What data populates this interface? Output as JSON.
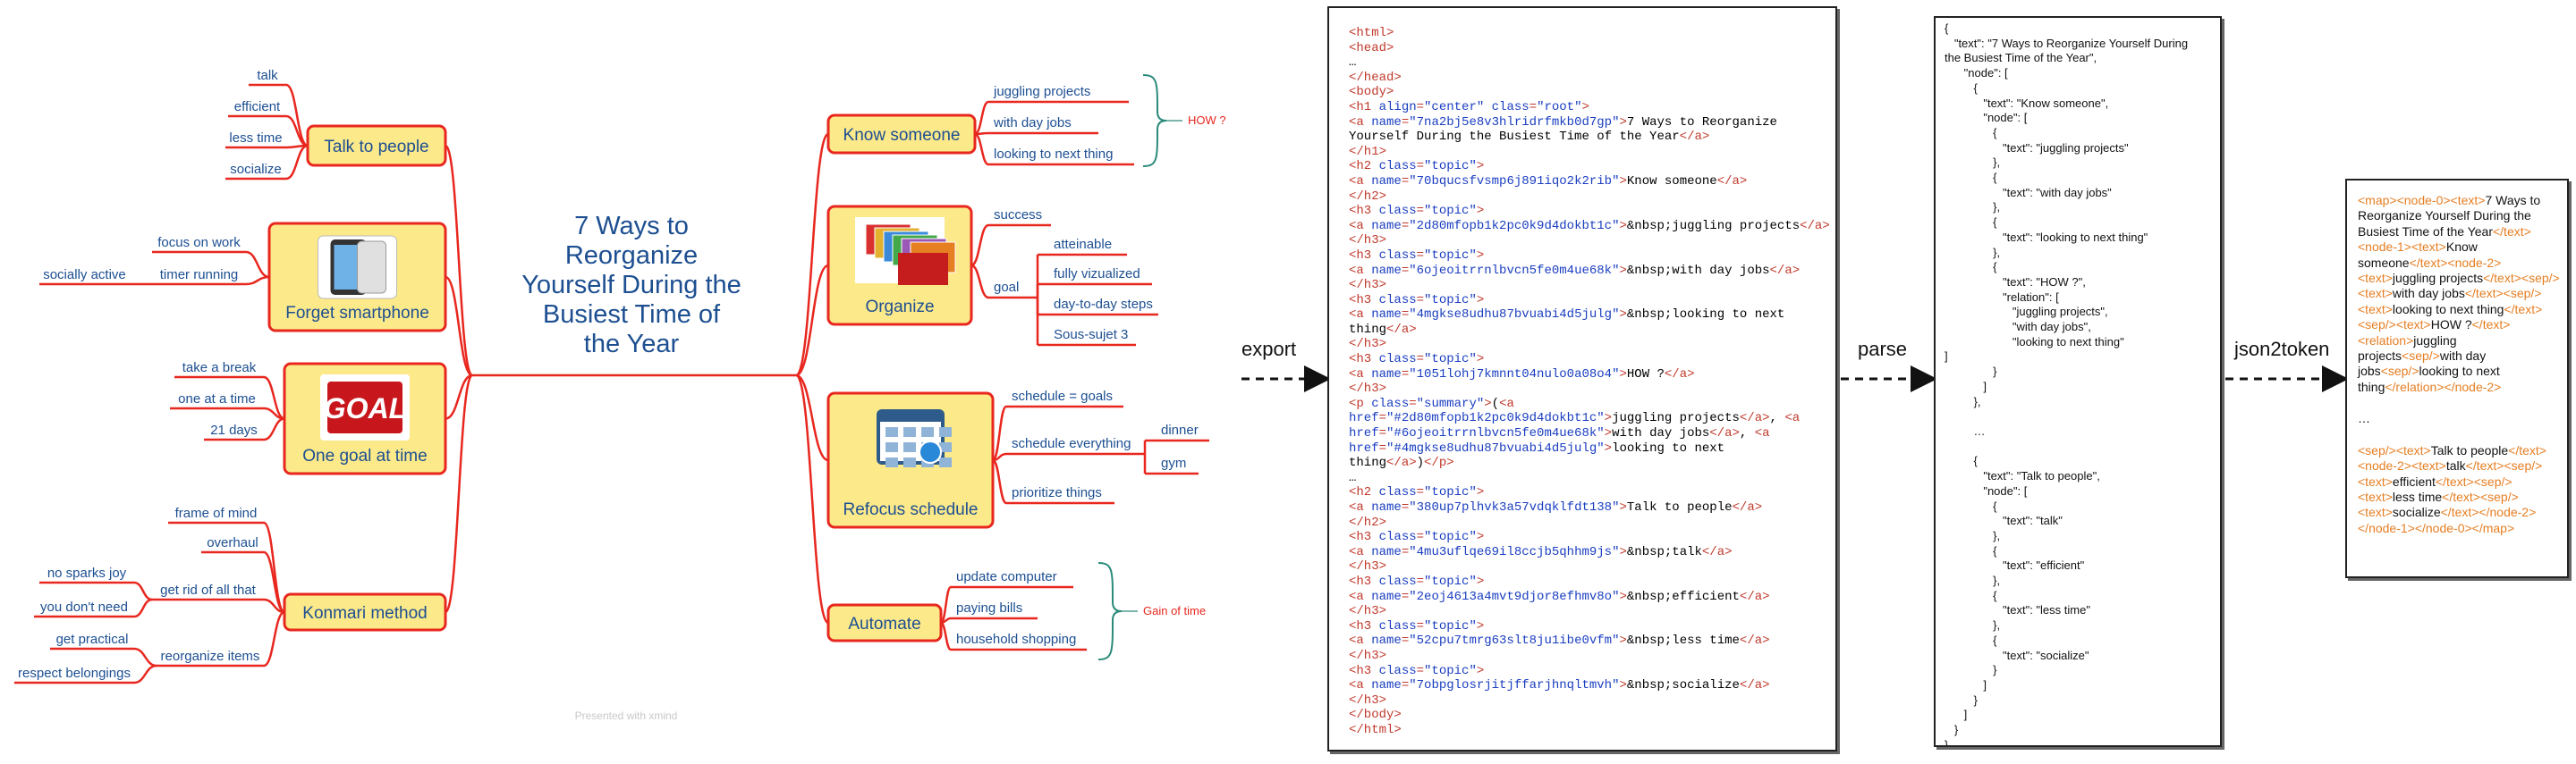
{
  "mindmap": {
    "central_topic": [
      "7 Ways to",
      "Reorganize",
      "Yourself During the",
      "Busiest Time of",
      "the Year"
    ],
    "watermark": "Presented with xmind",
    "left_topics": [
      {
        "label": "Talk to people",
        "image": null,
        "leaves": [
          {
            "label": "talk"
          },
          {
            "label": "efficient"
          },
          {
            "label": "less time"
          },
          {
            "label": "socialize"
          }
        ]
      },
      {
        "label": "Forget smartphone",
        "image": "smartphone-image",
        "leaves": [
          {
            "label": "focus on work"
          },
          {
            "label": "timer running",
            "children": [
              {
                "label": "socially active"
              }
            ]
          }
        ]
      },
      {
        "label": "One goal at time",
        "image": "goal-image",
        "leaves": [
          {
            "label": "take a break"
          },
          {
            "label": "one at a time"
          },
          {
            "label": "21 days"
          }
        ]
      },
      {
        "label": "Konmari method",
        "image": null,
        "leaves": [
          {
            "label": "frame of mind"
          },
          {
            "label": "overhaul"
          },
          {
            "label": "get rid of all that",
            "children": [
              {
                "label": "no sparks joy"
              },
              {
                "label": "you don't need"
              }
            ]
          },
          {
            "label": "reorganize items",
            "children": [
              {
                "label": "get practical"
              },
              {
                "label": "respect belongings"
              }
            ]
          }
        ]
      }
    ],
    "right_topics": [
      {
        "label": "Know someone",
        "image": null,
        "leaves": [
          {
            "label": "juggling projects"
          },
          {
            "label": "with day jobs"
          },
          {
            "label": "looking to next thing"
          }
        ],
        "summary": "HOW ?"
      },
      {
        "label": "Organize",
        "image": "folders-image",
        "leaves": [
          {
            "label": "success"
          },
          {
            "label": "goal",
            "children": [
              {
                "label": "atteinable"
              },
              {
                "label": "fully vizualized"
              },
              {
                "label": "day-to-day steps"
              },
              {
                "label": "Sous-sujet  3"
              }
            ]
          }
        ]
      },
      {
        "label": "Refocus schedule",
        "image": "calendar-image",
        "leaves": [
          {
            "label": "schedule = goals"
          },
          {
            "label": "schedule everything",
            "children": [
              {
                "label": "dinner"
              },
              {
                "label": "gym"
              }
            ]
          },
          {
            "label": "prioritize things"
          }
        ]
      },
      {
        "label": "Automate",
        "image": null,
        "leaves": [
          {
            "label": "update computer"
          },
          {
            "label": "paying bills"
          },
          {
            "label": "household shopping"
          }
        ],
        "summary": "Gain of time"
      }
    ]
  },
  "steps": {
    "export": "export",
    "parse": "parse",
    "json2token": "json2token"
  },
  "html_export": [
    [
      [
        "t",
        "<html>"
      ]
    ],
    [
      [
        "t",
        "<head>"
      ]
    ],
    [
      [
        "x",
        "…"
      ]
    ],
    [
      [
        "t",
        "</head>"
      ]
    ],
    [
      [
        "t",
        "<body>"
      ]
    ],
    [
      [
        "t",
        "<h1 "
      ],
      [
        "a",
        "align"
      ],
      [
        "t",
        "="
      ],
      [
        "a",
        "\"center\""
      ],
      [
        "t",
        " "
      ],
      [
        "a",
        "class"
      ],
      [
        "t",
        "="
      ],
      [
        "a",
        "\"root\""
      ],
      [
        "t",
        ">"
      ]
    ],
    [
      [
        "t",
        "<a "
      ],
      [
        "a",
        "name"
      ],
      [
        "t",
        "="
      ],
      [
        "a",
        "\"7na2bj5e8v3hlridrfmkb0d7gp\""
      ],
      [
        "t",
        ">"
      ],
      [
        "x",
        "7 Ways to Reorganize"
      ]
    ],
    [
      [
        "x",
        "Yourself During the Busiest Time of the Year"
      ],
      [
        "t",
        "</a>"
      ]
    ],
    [
      [
        "t",
        "</h1>"
      ]
    ],
    [
      [
        "t",
        "<h2 "
      ],
      [
        "a",
        "class"
      ],
      [
        "t",
        "="
      ],
      [
        "a",
        "\"topic\""
      ],
      [
        "t",
        ">"
      ]
    ],
    [
      [
        "t",
        "<a "
      ],
      [
        "a",
        "name"
      ],
      [
        "t",
        "="
      ],
      [
        "a",
        "\"70bqucsfvsmp6j891iqo2k2rib\""
      ],
      [
        "t",
        ">"
      ],
      [
        "x",
        "Know someone"
      ],
      [
        "t",
        "</a>"
      ]
    ],
    [
      [
        "t",
        "</h2>"
      ]
    ],
    [
      [
        "t",
        "<h3 "
      ],
      [
        "a",
        "class"
      ],
      [
        "t",
        "="
      ],
      [
        "a",
        "\"topic\""
      ],
      [
        "t",
        ">"
      ]
    ],
    [
      [
        "t",
        "<a "
      ],
      [
        "a",
        "name"
      ],
      [
        "t",
        "="
      ],
      [
        "a",
        "\"2d80mfopb1k2pc0k9d4dokbt1c\""
      ],
      [
        "t",
        ">"
      ],
      [
        "x",
        "&nbsp;juggling projects"
      ],
      [
        "t",
        "</a>"
      ]
    ],
    [
      [
        "t",
        "</h3>"
      ]
    ],
    [
      [
        "t",
        "<h3 "
      ],
      [
        "a",
        "class"
      ],
      [
        "t",
        "="
      ],
      [
        "a",
        "\"topic\""
      ],
      [
        "t",
        ">"
      ]
    ],
    [
      [
        "t",
        "<a "
      ],
      [
        "a",
        "name"
      ],
      [
        "t",
        "="
      ],
      [
        "a",
        "\"6ojeoitrrnlbvcn5fe0m4ue68k\""
      ],
      [
        "t",
        ">"
      ],
      [
        "x",
        "&nbsp;with day jobs"
      ],
      [
        "t",
        "</a>"
      ]
    ],
    [
      [
        "t",
        "</h3>"
      ]
    ],
    [
      [
        "t",
        "<h3 "
      ],
      [
        "a",
        "class"
      ],
      [
        "t",
        "="
      ],
      [
        "a",
        "\"topic\""
      ],
      [
        "t",
        ">"
      ]
    ],
    [
      [
        "t",
        "<a "
      ],
      [
        "a",
        "name"
      ],
      [
        "t",
        "="
      ],
      [
        "a",
        "\"4mgkse8udhu87bvuabi4d5julg\""
      ],
      [
        "t",
        ">"
      ],
      [
        "x",
        "&nbsp;looking to next"
      ]
    ],
    [
      [
        "x",
        "thing"
      ],
      [
        "t",
        "</a>"
      ]
    ],
    [
      [
        "t",
        "</h3>"
      ]
    ],
    [
      [
        "t",
        "<h3 "
      ],
      [
        "a",
        "class"
      ],
      [
        "t",
        "="
      ],
      [
        "a",
        "\"topic\""
      ],
      [
        "t",
        ">"
      ]
    ],
    [
      [
        "t",
        "<a "
      ],
      [
        "a",
        "name"
      ],
      [
        "t",
        "="
      ],
      [
        "a",
        "\"1051lohj7kmnnt04nulo0a08o4\""
      ],
      [
        "t",
        ">"
      ],
      [
        "x",
        "HOW ?"
      ],
      [
        "t",
        "</a>"
      ]
    ],
    [
      [
        "t",
        "</h3>"
      ]
    ],
    [
      [
        "t",
        "<p "
      ],
      [
        "a",
        "class"
      ],
      [
        "t",
        "="
      ],
      [
        "a",
        "\"summary\""
      ],
      [
        "t",
        ">"
      ],
      [
        "x",
        "("
      ],
      [
        "t",
        "<a"
      ]
    ],
    [
      [
        "a",
        "href"
      ],
      [
        "t",
        "="
      ],
      [
        "a",
        "\"#2d80mfopb1k2pc0k9d4dokbt1c\""
      ],
      [
        "t",
        ">"
      ],
      [
        "x",
        "juggling projects"
      ],
      [
        "t",
        "</a>"
      ],
      [
        "x",
        ", "
      ],
      [
        "t",
        "<a"
      ]
    ],
    [
      [
        "a",
        "href"
      ],
      [
        "t",
        "="
      ],
      [
        "a",
        "\"#6ojeoitrrnlbvcn5fe0m4ue68k\""
      ],
      [
        "t",
        ">"
      ],
      [
        "x",
        "with day jobs"
      ],
      [
        "t",
        "</a>"
      ],
      [
        "x",
        ", "
      ],
      [
        "t",
        "<a"
      ]
    ],
    [
      [
        "a",
        "href"
      ],
      [
        "t",
        "="
      ],
      [
        "a",
        "\"#4mgkse8udhu87bvuabi4d5julg\""
      ],
      [
        "t",
        ">"
      ],
      [
        "x",
        "looking to next"
      ]
    ],
    [
      [
        "x",
        "thing"
      ],
      [
        "t",
        "</a>"
      ],
      [
        "x",
        ")"
      ],
      [
        "t",
        "</p>"
      ]
    ],
    [
      [
        "x",
        "…"
      ]
    ],
    [
      [
        "t",
        "<h2 "
      ],
      [
        "a",
        "class"
      ],
      [
        "t",
        "="
      ],
      [
        "a",
        "\"topic\""
      ],
      [
        "t",
        ">"
      ]
    ],
    [
      [
        "t",
        "<a "
      ],
      [
        "a",
        "name"
      ],
      [
        "t",
        "="
      ],
      [
        "a",
        "\"380up7plhvk3a57vdqklfdt138\""
      ],
      [
        "t",
        ">"
      ],
      [
        "x",
        "Talk to people"
      ],
      [
        "t",
        "</a>"
      ]
    ],
    [
      [
        "t",
        "</h2>"
      ]
    ],
    [
      [
        "t",
        "<h3 "
      ],
      [
        "a",
        "class"
      ],
      [
        "t",
        "="
      ],
      [
        "a",
        "\"topic\""
      ],
      [
        "t",
        ">"
      ]
    ],
    [
      [
        "t",
        "<a "
      ],
      [
        "a",
        "name"
      ],
      [
        "t",
        "="
      ],
      [
        "a",
        "\"4mu3uflqe69il8ccjb5qhhm9js\""
      ],
      [
        "t",
        ">"
      ],
      [
        "x",
        "&nbsp;talk"
      ],
      [
        "t",
        "</a>"
      ]
    ],
    [
      [
        "t",
        "</h3>"
      ]
    ],
    [
      [
        "t",
        "<h3 "
      ],
      [
        "a",
        "class"
      ],
      [
        "t",
        "="
      ],
      [
        "a",
        "\"topic\""
      ],
      [
        "t",
        ">"
      ]
    ],
    [
      [
        "t",
        "<a "
      ],
      [
        "a",
        "name"
      ],
      [
        "t",
        "="
      ],
      [
        "a",
        "\"2eoj4613a4mvt9djor8efhmv8o\""
      ],
      [
        "t",
        ">"
      ],
      [
        "x",
        "&nbsp;efficient"
      ],
      [
        "t",
        "</a>"
      ]
    ],
    [
      [
        "t",
        "</h3>"
      ]
    ],
    [
      [
        "t",
        "<h3 "
      ],
      [
        "a",
        "class"
      ],
      [
        "t",
        "="
      ],
      [
        "a",
        "\"topic\""
      ],
      [
        "t",
        ">"
      ]
    ],
    [
      [
        "t",
        "<a "
      ],
      [
        "a",
        "name"
      ],
      [
        "t",
        "="
      ],
      [
        "a",
        "\"52cpu7tmrg63slt8ju1ibe0vfm\""
      ],
      [
        "t",
        ">"
      ],
      [
        "x",
        "&nbsp;less time"
      ],
      [
        "t",
        "</a>"
      ]
    ],
    [
      [
        "t",
        "</h3>"
      ]
    ],
    [
      [
        "t",
        "<h3 "
      ],
      [
        "a",
        "class"
      ],
      [
        "t",
        "="
      ],
      [
        "a",
        "\"topic\""
      ],
      [
        "t",
        ">"
      ]
    ],
    [
      [
        "t",
        "<a "
      ],
      [
        "a",
        "name"
      ],
      [
        "t",
        "="
      ],
      [
        "a",
        "\"7obpglosrjitjffarjhnqltmvh\""
      ],
      [
        "t",
        ">"
      ],
      [
        "x",
        "&nbsp;socialize"
      ],
      [
        "t",
        "</a>"
      ]
    ],
    [
      [
        "t",
        "</h3>"
      ]
    ],
    [
      [
        "t",
        "</body>"
      ]
    ],
    [
      [
        "t",
        "</html>"
      ]
    ]
  ],
  "json_export": [
    "{",
    "   \"text\": \"7 Ways to Reorganize Yourself During",
    "the Busiest Time of the Year\",",
    "      \"node\": [",
    "         {",
    "            \"text\": \"Know someone\",",
    "            \"node\": [",
    "               {",
    "                  \"text\": \"juggling projects\"",
    "               },",
    "               {",
    "                  \"text\": \"with day jobs\"",
    "               },",
    "               {",
    "                  \"text\": \"looking to next thing\"",
    "               },",
    "               {",
    "                  \"text\": \"HOW ?\",",
    "                  \"relation\": [",
    "                     \"juggling projects\",",
    "                     \"with day jobs\",",
    "                     \"looking to next thing\"",
    "]",
    "               }",
    "            ]",
    "         },",
    "",
    "         …",
    "",
    "         {",
    "            \"text\": \"Talk to people\",",
    "            \"node\": [",
    "               {",
    "                  \"text\": \"talk\"",
    "               },",
    "               {",
    "                  \"text\": \"efficient\"",
    "               },",
    "               {",
    "                  \"text\": \"less time\"",
    "               },",
    "               {",
    "                  \"text\": \"socialize\"",
    "               }",
    "            ]",
    "         }",
    "      ]",
    "   }",
    "}"
  ],
  "token_export": [
    [
      [
        "o",
        "<map><node-0><text>"
      ],
      [
        "b",
        "7 Ways to Reorganize Yourself During the Busiest Time of the Year"
      ],
      [
        "o",
        "</text><node-1><text>"
      ],
      [
        "b",
        "Know someone"
      ],
      [
        "o",
        "</text><node-2><text>"
      ],
      [
        "b",
        "juggling projects"
      ],
      [
        "o",
        "</text><sep/><text>"
      ],
      [
        "b",
        "with day jobs"
      ],
      [
        "o",
        "</text><sep/><text>"
      ],
      [
        "b",
        "looking to next thing"
      ],
      [
        "o",
        "</text><sep/><text>"
      ],
      [
        "b",
        "HOW ?"
      ],
      [
        "o",
        "</text><relation>"
      ],
      [
        "b",
        "juggling projects"
      ],
      [
        "o",
        "<sep/>"
      ],
      [
        "b",
        "with day jobs"
      ],
      [
        "o",
        "<sep/>"
      ],
      [
        "b",
        "looking to next thing"
      ],
      [
        "o",
        "</relation></node-2>"
      ]
    ],
    [
      [
        "b",
        "…"
      ]
    ],
    [
      [
        "o",
        "<sep/><text>"
      ],
      [
        "b",
        "Talk to people"
      ],
      [
        "o",
        "</text><node-2><text>"
      ],
      [
        "b",
        "talk"
      ],
      [
        "o",
        "</text><sep/><text>"
      ],
      [
        "b",
        "efficient"
      ],
      [
        "o",
        "</text><sep/><text>"
      ],
      [
        "b",
        "less time"
      ],
      [
        "o",
        "</text><sep/><text>"
      ],
      [
        "b",
        "socialize"
      ],
      [
        "o",
        "</text></node-2></node-1></node-0></map>"
      ]
    ]
  ]
}
